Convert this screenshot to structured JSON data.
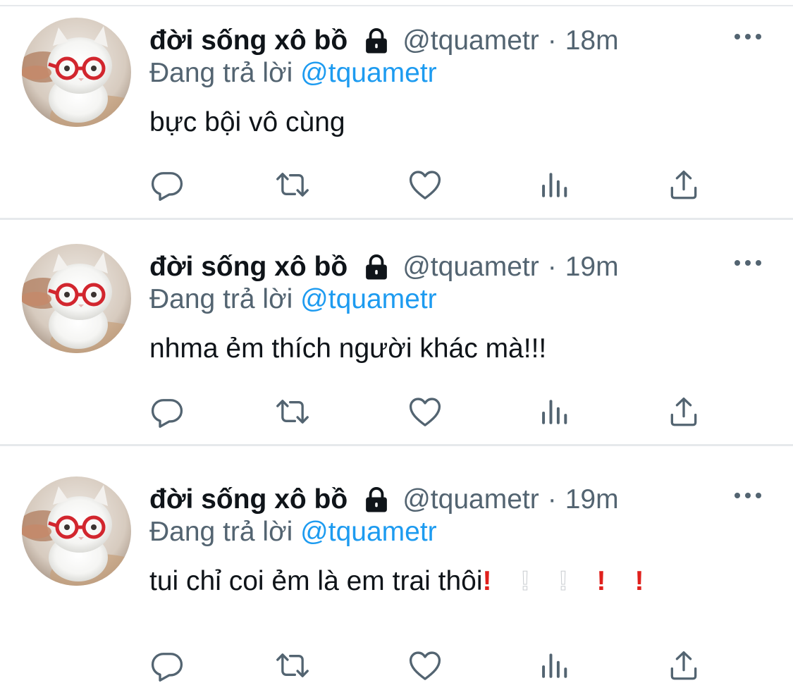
{
  "tweets": [
    {
      "display_name": "đời sống xô bồ",
      "handle": "@tquametr",
      "separator": "·",
      "time": "19m",
      "reply_prefix": "Đang trả lời",
      "reply_to": "@tquametr",
      "text": "nhma ẻm thích người khác mà!!!",
      "emoji_marks": []
    },
    {
      "display_name": "đời sống xô bồ",
      "handle": "@tquametr",
      "separator": "·",
      "time": "19m",
      "reply_prefix": "Đang trả lời",
      "reply_to": "@tquametr",
      "text": "tui chỉ coi ẻm là em trai thôi",
      "emoji_marks": [
        {
          "glyph": "!",
          "color": "red"
        },
        {
          "glyph": "!",
          "color": "white"
        },
        {
          "glyph": "!",
          "color": "white"
        },
        {
          "glyph": "!",
          "color": "red"
        },
        {
          "glyph": "!",
          "color": "red"
        }
      ]
    },
    {
      "display_name": "đời sống xô bồ",
      "handle": "@tquametr",
      "separator": "·",
      "time": "18m",
      "reply_prefix": "Đang trả lời",
      "reply_to": "@tquametr",
      "text": "bực bội vô cùng",
      "emoji_marks": []
    }
  ],
  "icons": {
    "lock": "lock-icon",
    "more": "more-horizontal-icon",
    "reply": "reply-icon",
    "retweet": "retweet-icon",
    "like": "heart-icon",
    "views": "views-chart-icon",
    "share": "share-icon"
  },
  "colors": {
    "text_primary": "#0f1419",
    "text_secondary": "#536471",
    "link": "#1d9bf0",
    "divider": "#e6e9ec",
    "icon": "#536471",
    "emoji_red": "#e0201c"
  }
}
